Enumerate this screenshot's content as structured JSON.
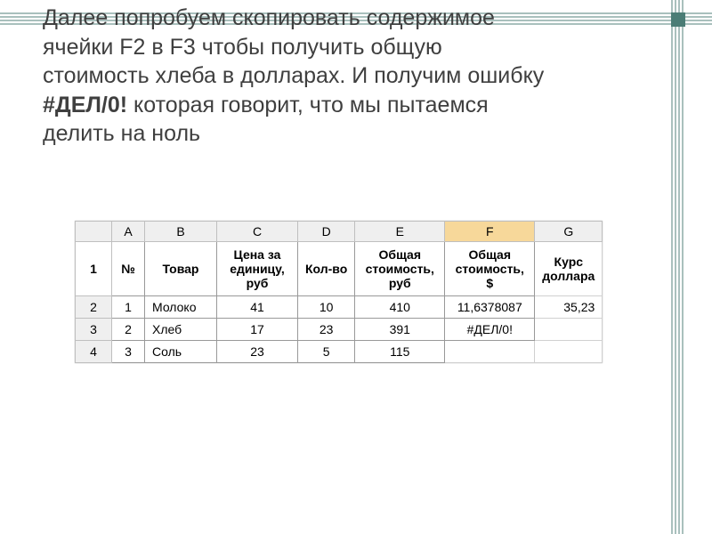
{
  "paragraph": {
    "p1a": "Далее попробуем скопировать содержимое",
    "p1b": "ячейки F2 в F3 чтобы получить общую",
    "p1c": "стоимость хлеба в долларах. И получим ошибку",
    "err": "#ДЕЛ/0!",
    "p1d": " которая говорит, что мы пытаемся",
    "p1e": "делить на ноль"
  },
  "sheet": {
    "columns": {
      "A": "A",
      "B": "B",
      "C": "C",
      "D": "D",
      "E": "E",
      "F": "F",
      "G": "G"
    },
    "rownums": {
      "r1": "1",
      "r2": "2",
      "r3": "3",
      "r4": "4"
    },
    "headers": {
      "no": "№",
      "product": "Товар",
      "price_unit_l1": "Цена за",
      "price_unit_l2": "единицу,",
      "price_unit_l3": "руб",
      "qty": "Кол-во",
      "total_rub_l1": "Общая",
      "total_rub_l2": "стоимость,",
      "total_rub_l3": "руб",
      "total_usd_l1": "Общая",
      "total_usd_l2": "стоимость,",
      "total_usd_l3": "$",
      "rate_l1": "Курс",
      "rate_l2": "доллара"
    },
    "rows": [
      {
        "no": "1",
        "product": "Молоко",
        "price": "41",
        "qty": "10",
        "total_rub": "410",
        "total_usd": "11,6378087",
        "rate": "35,23"
      },
      {
        "no": "2",
        "product": "Хлеб",
        "price": "17",
        "qty": "23",
        "total_rub": "391",
        "total_usd": "#ДЕЛ/0!",
        "rate": ""
      },
      {
        "no": "3",
        "product": "Соль",
        "price": "23",
        "qty": "5",
        "total_rub": "115",
        "total_usd": "",
        "rate": ""
      }
    ]
  }
}
